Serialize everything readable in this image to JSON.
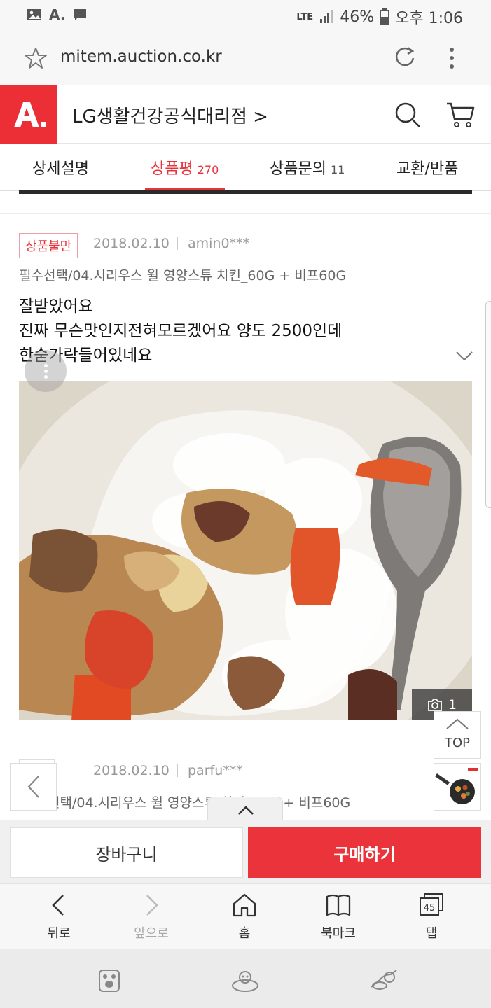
{
  "status_bar": {
    "network": "LTE",
    "battery": "46%",
    "time": "오후 1:06",
    "notification_icons": [
      "image-icon",
      "auction-app-icon",
      "chat-icon"
    ]
  },
  "browser": {
    "url": "mitem.auction.co.kr"
  },
  "shop": {
    "logo": "A.",
    "name": "LG생활건강공식대리점 >",
    "brand_color": "#ec2f36"
  },
  "tabs": [
    {
      "label": "상세설명",
      "count": ""
    },
    {
      "label": "상품평",
      "count": "270"
    },
    {
      "label": "상품문의",
      "count": "11"
    },
    {
      "label": "교환/반품",
      "count": ""
    }
  ],
  "reviews": [
    {
      "badge": "상품불만",
      "date": "2018.02.10",
      "user": "amin0***",
      "option": "필수선택/04.시리우스 윌 영양스튜 치킨_60G + 비프60G",
      "lines": [
        "잘받았어요",
        "진짜 무슨맛인지전혀모르겠어요 양도 2500인데",
        "한숟가락들어있네요"
      ],
      "photo_count": "1"
    },
    {
      "badge": "만족",
      "date": "2018.02.10",
      "user": "parfu***",
      "option": "선택/04.시리우스 윌 영양스튜 치킨_60G + 비프60G"
    }
  ],
  "floating": {
    "top_label": "TOP"
  },
  "actions": {
    "cart": "장바구니",
    "buy": "구매하기"
  },
  "nav": [
    {
      "label": "뒤로"
    },
    {
      "label": "앞으로"
    },
    {
      "label": "홈"
    },
    {
      "label": "북마크"
    },
    {
      "label": "탭",
      "badge": "45"
    }
  ]
}
